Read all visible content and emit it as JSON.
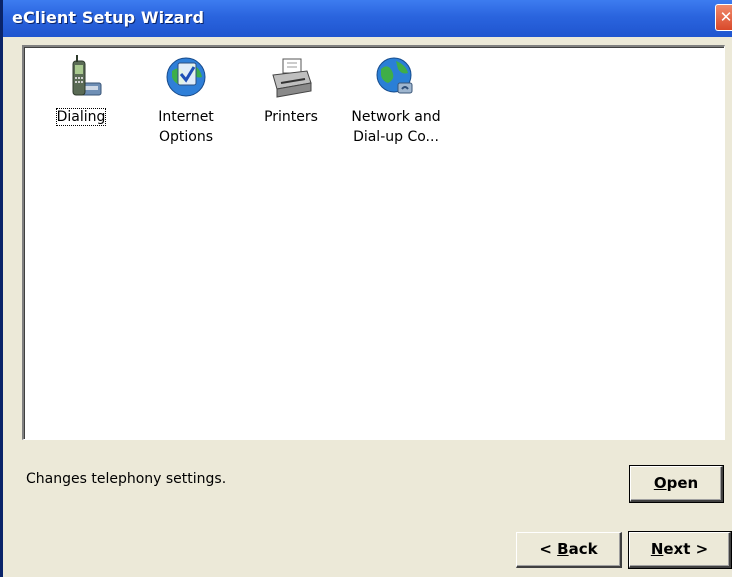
{
  "window": {
    "title": "eClient Setup Wizard",
    "close_glyph": "✕"
  },
  "list": {
    "items": [
      {
        "label": "Dialing",
        "icon": "phone-icon",
        "selected": true
      },
      {
        "label": "Internet\nOptions",
        "icon": "internet-options-icon",
        "selected": false
      },
      {
        "label": "Printers",
        "icon": "printer-icon",
        "selected": false
      },
      {
        "label": "Network and\nDial-up Co...",
        "icon": "network-globe-icon",
        "selected": false
      }
    ]
  },
  "status": {
    "description": "Changes telephony settings."
  },
  "buttons": {
    "open": {
      "accel": "O",
      "rest": "pen"
    },
    "back": {
      "prefix": "< ",
      "accel": "B",
      "rest": "ack"
    },
    "next": {
      "accel": "N",
      "rest": "ext >"
    }
  },
  "colors": {
    "titlebar": "#2a64de",
    "window_bg": "#ece9d8",
    "list_bg": "#ffffff",
    "close_button": "#d9492a"
  }
}
